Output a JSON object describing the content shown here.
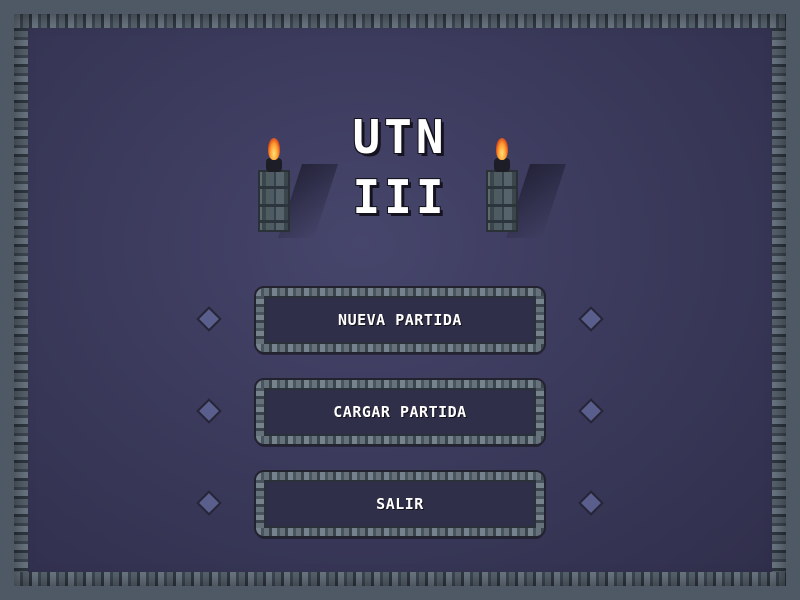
{
  "title": {
    "line1": "UTN",
    "line2": "III"
  },
  "menu": {
    "items": [
      {
        "id": "new-game",
        "label": "NUEVA PARTIDA"
      },
      {
        "id": "load-game",
        "label": "CARGAR PARTIDA"
      },
      {
        "id": "exit",
        "label": "SALIR"
      }
    ]
  },
  "colors": {
    "background": "#3b3a5c",
    "stone_border": "#5e6a76",
    "button_fill": "#2f2f49",
    "text": "#ffffff",
    "diamond": "#5a5e8c",
    "flame": "#ff9a2e"
  },
  "icons": {
    "torch": "torch-icon",
    "selector": "diamond-icon"
  }
}
